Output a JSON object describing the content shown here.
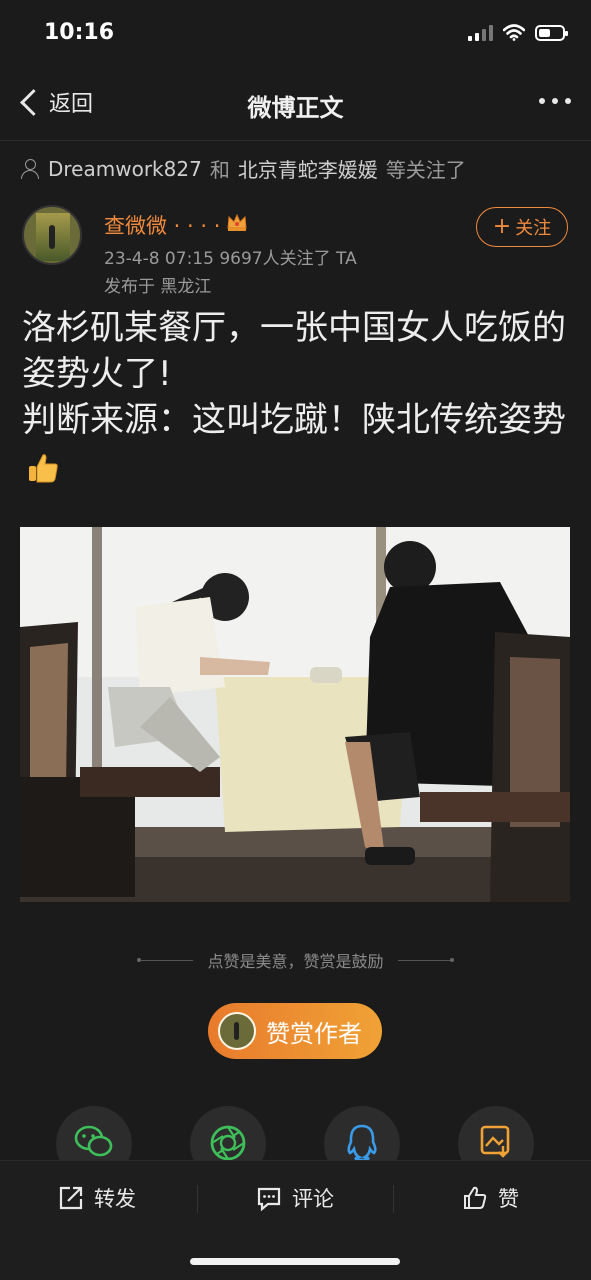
{
  "status_bar": {
    "time": "10:16"
  },
  "nav": {
    "back_label": "返回",
    "title": "微博正文"
  },
  "followed_by": {
    "user1": "Dreamwork827",
    "and": "和",
    "user2": "北京青蛇李媛媛",
    "suffix": "等关注了"
  },
  "author": {
    "name": "查微微 · · · ·",
    "meta": "23-4-8 07:15  9697人关注了 TA",
    "location": "发布于 黑龙江",
    "follow_label": "关注"
  },
  "post": {
    "line1": "洛杉矶某餐厅，一张中国女人吃饭的姿势火了!",
    "line2": "判断来源：这叫圪蹴！陕北传统姿势"
  },
  "encourage_text": "点赞是美意，赞赏是鼓励",
  "reward_label": "赞赏作者",
  "share": [
    "wechat-icon",
    "moments-icon",
    "qq-icon",
    "save-image-icon"
  ],
  "toolbar": {
    "repost": "转发",
    "comment": "评论",
    "like": "赞"
  },
  "colors": {
    "accent": "#f08a3c",
    "background": "#1b1b1b"
  }
}
